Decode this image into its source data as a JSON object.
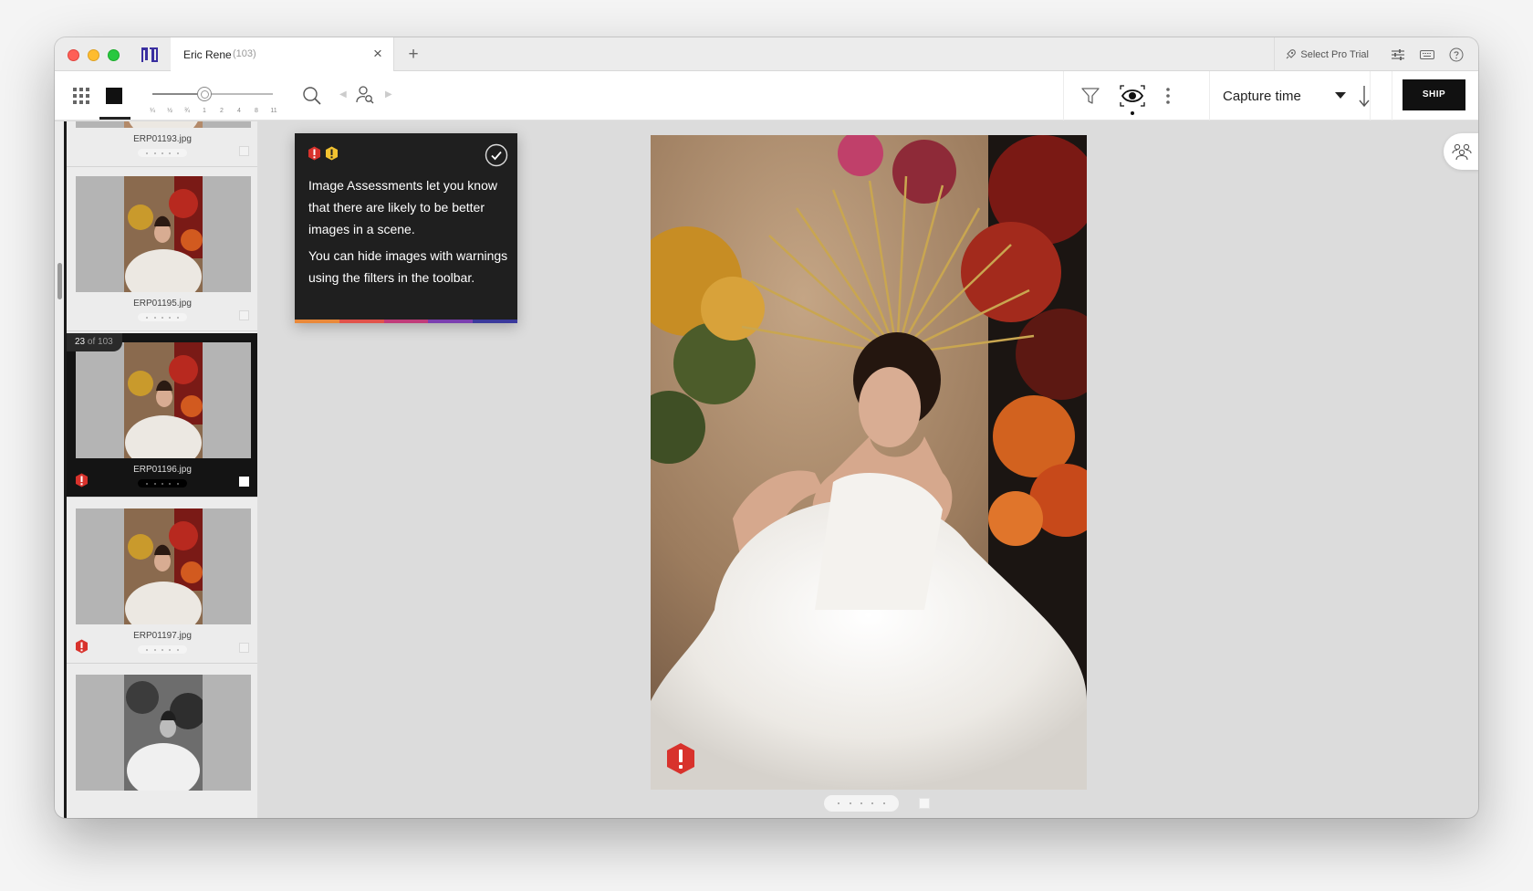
{
  "window": {
    "tab_title": "Eric Rene",
    "tab_count": "(103)",
    "tab_close": "×",
    "new_tab": "+",
    "pro_trial_label": "Select Pro Trial",
    "icons": [
      "app-logo-icon",
      "rocket-icon",
      "sliders-icon",
      "keyboard-icon",
      "help-icon"
    ]
  },
  "toolbar": {
    "zoom_ticks": [
      "¼",
      "½",
      "¾",
      "1",
      "2",
      "4",
      "8",
      "11"
    ],
    "sort_label": "Capture time",
    "ship_label": "SHIP",
    "view_mode": "loupe",
    "zoom_level": "1"
  },
  "sidebar": {
    "items": [
      {
        "filename": "ERP01193.jpg",
        "selected": false,
        "warning": false
      },
      {
        "filename": "ERP01195.jpg",
        "selected": false,
        "warning": false
      },
      {
        "filename": "ERP01196.jpg",
        "selected": true,
        "warning": true,
        "position": "23",
        "of_label": "of 103"
      },
      {
        "filename": "ERP01197.jpg",
        "selected": false,
        "warning": true
      },
      {
        "filename": "",
        "selected": false,
        "warning": false,
        "monochrome": true
      }
    ]
  },
  "tooltip": {
    "paragraph1": "Image Assessments let you know that there are likely to be better images in a scene.",
    "paragraph2": "You can hide images with warnings using the filters in the toolbar.",
    "stripe_colors": [
      "#e9893a",
      "#e1534b",
      "#c13c7a",
      "#7b3fb0",
      "#3b3a9c"
    ]
  },
  "colors": {
    "warning_red": "#d8322c",
    "warning_yellow": "#f2c230",
    "ship_bg": "#111111"
  }
}
